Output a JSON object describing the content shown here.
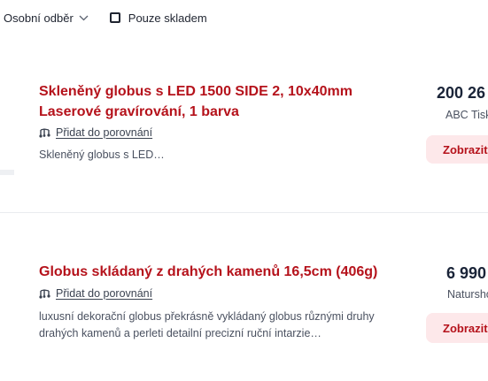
{
  "filters": {
    "pickup_label": "Osobní odběr",
    "in_stock_label": "Pouze skladem"
  },
  "products": [
    {
      "title_line1": "Skleněný globus s LED 1500 SIDE 2, 10x40mm",
      "title_line2": "Laserové gravírování, 1 barva",
      "compare_label": "Přidat do porovnání",
      "description": "Skleněný globus s LED…",
      "price": "200 26",
      "shop": "ABC Tisk",
      "show_label": "Zobrazit"
    },
    {
      "title_line1": "Globus skládaný z drahých kamenů 16,5cm (406g)",
      "compare_label": "Přidat do porovnání",
      "description_line1": "luxusní dekorační globus překrásně vykládaný globus různými druhy",
      "description_line2": "drahých kamenů a perleti detailní precizní ruční intarzie…",
      "price": "6 990",
      "shop": "Naturshop",
      "show_label": "Zobrazit"
    }
  ],
  "icons": {
    "dropdown": "chevron-down-icon",
    "compare": "compare-scale-icon"
  },
  "colors": {
    "title": "#b5121b",
    "button_bg": "#fde8ea",
    "price": "#1a2438"
  }
}
